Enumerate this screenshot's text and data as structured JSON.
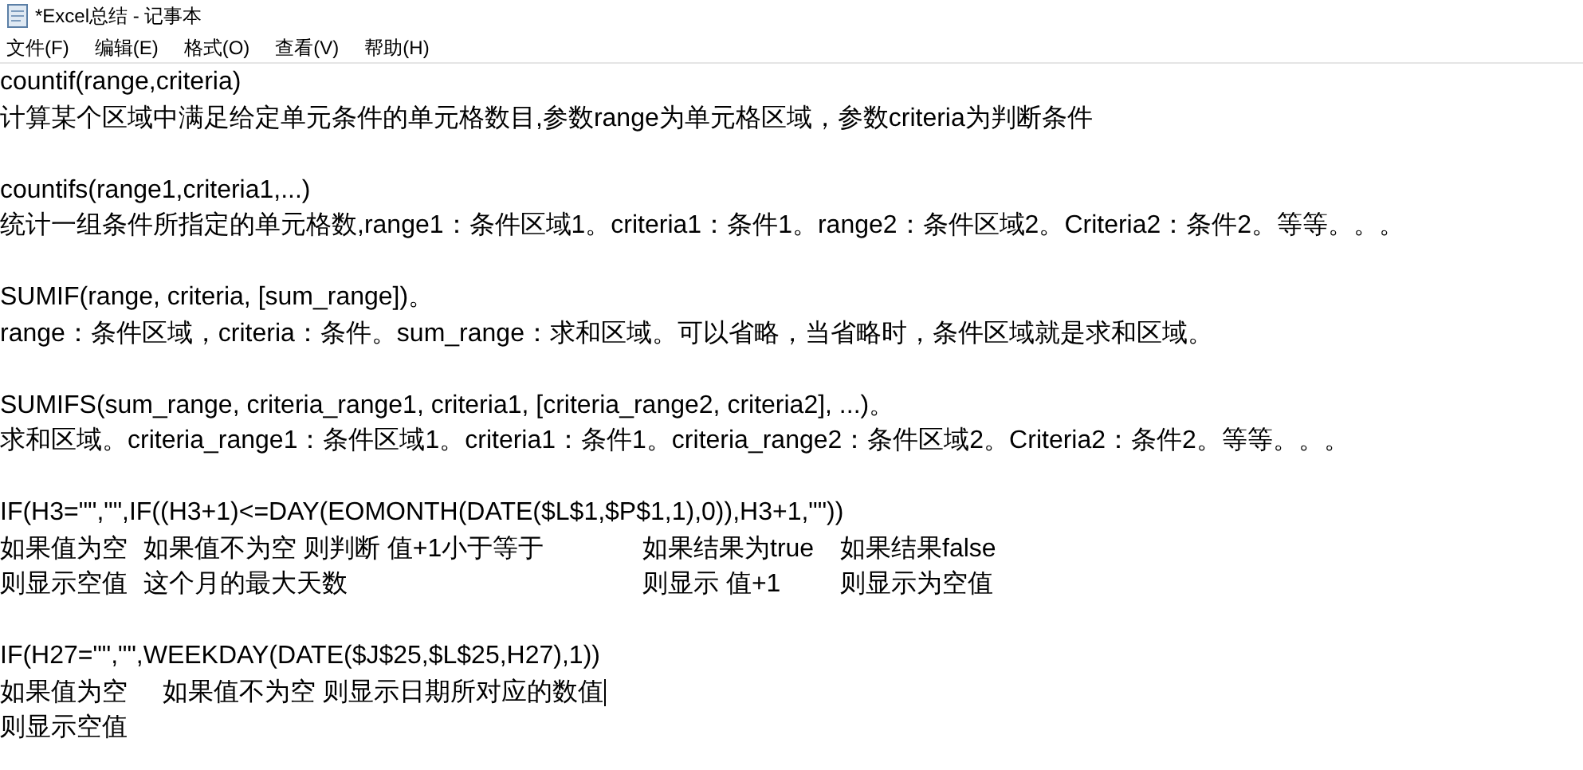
{
  "window": {
    "title": "*Excel总结 - 记事本"
  },
  "menu": [
    "文件(F)",
    "编辑(E)",
    "格式(O)",
    "查看(V)",
    "帮助(H)"
  ],
  "lines": [
    {
      "kind": "text",
      "text": "countif(range,criteria)"
    },
    {
      "kind": "text",
      "text": "计算某个区域中满足给定单元条件的单元格数目,参数range为单元格区域，参数criteria为判断条件"
    },
    {
      "kind": "blank"
    },
    {
      "kind": "text",
      "text": "countifs(range1,criteria1,...)"
    },
    {
      "kind": "text",
      "text": "统计一组条件所指定的单元格数,range1：条件区域1。criteria1：条件1。range2：条件区域2。Criteria2：条件2。等等。。。"
    },
    {
      "kind": "blank"
    },
    {
      "kind": "text",
      "text": "SUMIF(range, criteria, [sum_range])。"
    },
    {
      "kind": "text",
      "text": "range：条件区域，criteria：条件。sum_range：求和区域。可以省略，当省略时，条件区域就是求和区域。"
    },
    {
      "kind": "blank"
    },
    {
      "kind": "text",
      "text": "SUMIFS(sum_range, criteria_range1, criteria1, [criteria_range2, criteria2], ...)。"
    },
    {
      "kind": "text",
      "text": "求和区域。criteria_range1：条件区域1。criteria1：条件1。criteria_range2：条件区域2。Criteria2：条件2。等等。。。"
    },
    {
      "kind": "blank"
    },
    {
      "kind": "text",
      "text": "IF(H3=\"\",\"\",IF((H3+1)<=DAY(EOMONTH(DATE($L$1,$P$1,1),0)),H3+1,\"\"))"
    },
    {
      "kind": "columns",
      "cells": [
        "如果值为空",
        "如果值不为空 则判断 值+1小于等于",
        "如果结果为true",
        "如果结果false"
      ]
    },
    {
      "kind": "columns",
      "cells": [
        "则显示空值",
        "这个月的最大天数",
        "则显示 值+1",
        "则显示为空值"
      ]
    },
    {
      "kind": "blank"
    },
    {
      "kind": "text",
      "text": "IF(H27=\"\",\"\",WEEKDAY(DATE($J$25,$L$25,H27),1))"
    },
    {
      "kind": "text",
      "text": "如果值为空     如果值不为空 则显示日期所对应的数值",
      "caret": true
    },
    {
      "kind": "text",
      "text": "则显示空值"
    }
  ]
}
